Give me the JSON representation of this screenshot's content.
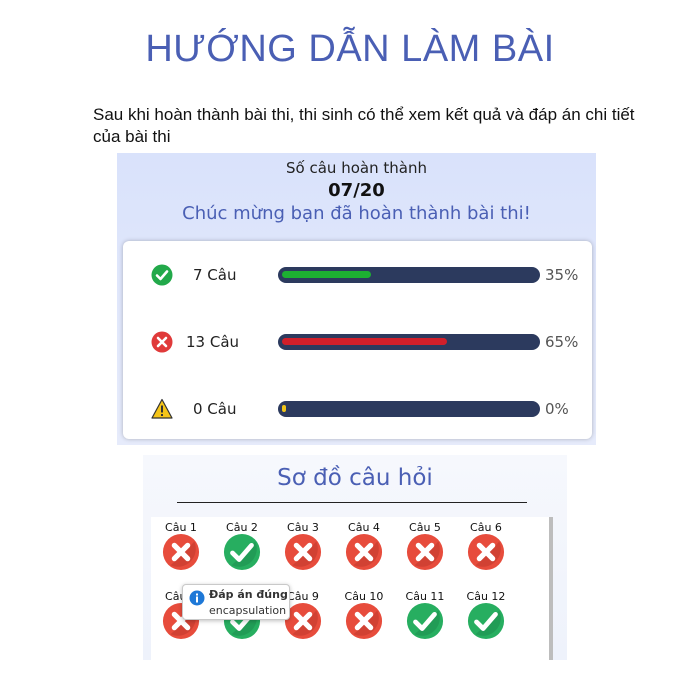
{
  "header": {
    "title": "HƯỚNG DẪN LÀM BÀI",
    "intro": "Sau khi hoàn thành bài thi, thi sinh có thể xem kết quả và đáp án chi tiết của bài thi"
  },
  "result": {
    "caption": "Số câu hoàn thành",
    "score": "07/20",
    "congrats": "Chúc mừng bạn đã hoàn thành bài thi!",
    "stats": [
      {
        "icon": "check-circle-icon",
        "label": "7 Câu",
        "percent_text": "35%",
        "fraction": 0.35,
        "color": "#1db032"
      },
      {
        "icon": "x-circle-icon",
        "label": "13 Câu",
        "percent_text": "65%",
        "fraction": 0.65,
        "color": "#d11f2a"
      },
      {
        "icon": "warning-triangle-icon",
        "label": "0 Câu",
        "percent_text": "0%",
        "fraction": 0.0,
        "color": "#f0c419"
      }
    ]
  },
  "question_map": {
    "title": "Sơ đồ câu hỏi",
    "questions": [
      {
        "label": "Câu 1",
        "status": "wrong"
      },
      {
        "label": "Câu 2",
        "status": "correct"
      },
      {
        "label": "Câu 3",
        "status": "wrong"
      },
      {
        "label": "Câu 4",
        "status": "wrong"
      },
      {
        "label": "Câu 5",
        "status": "wrong"
      },
      {
        "label": "Câu 6",
        "status": "wrong"
      },
      {
        "label": "Câu 7",
        "status": "wrong"
      },
      {
        "label": "Câu 8",
        "status": "correct"
      },
      {
        "label": "Câu 9",
        "status": "wrong"
      },
      {
        "label": "Câu 10",
        "status": "wrong"
      },
      {
        "label": "Câu 11",
        "status": "correct"
      },
      {
        "label": "Câu 12",
        "status": "correct"
      }
    ],
    "tooltip": {
      "title": "Đáp án đúng",
      "value": "encapsulation"
    }
  },
  "colors": {
    "accent": "#4a5fb4",
    "correct": "#27ae60",
    "wrong": "#e74c3c",
    "bar_track": "#2c3a5e"
  }
}
